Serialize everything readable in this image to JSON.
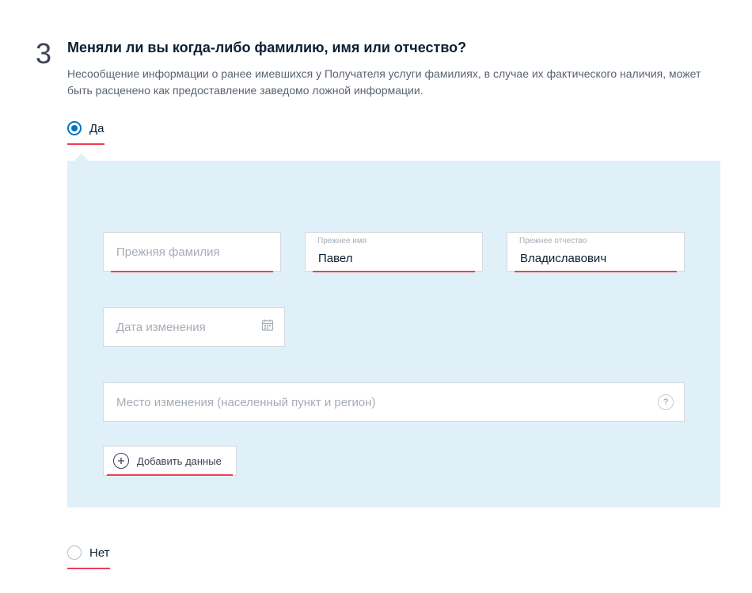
{
  "step_number": "3",
  "title": "Меняли ли вы когда-либо фамилию, имя или отчество?",
  "description": "Несообщение информации о ранее имевшихся у Получателя услуги фамилиях, в случае их фактического наличия, может быть расценено как предоставление заведомо ложной информации.",
  "radio_yes": "Да",
  "radio_no": "Нет",
  "fields": {
    "surname": {
      "placeholder": "Прежняя фамилия",
      "value": ""
    },
    "name": {
      "label": "Прежнее имя",
      "value": "Павел"
    },
    "patronymic": {
      "label": "Прежнее отчество",
      "value": "Владиславович"
    },
    "date": {
      "placeholder": "Дата изменения"
    },
    "place": {
      "placeholder": "Место изменения (населенный пункт и регион)"
    }
  },
  "add_button": "Добавить данные",
  "help_icon": "?"
}
